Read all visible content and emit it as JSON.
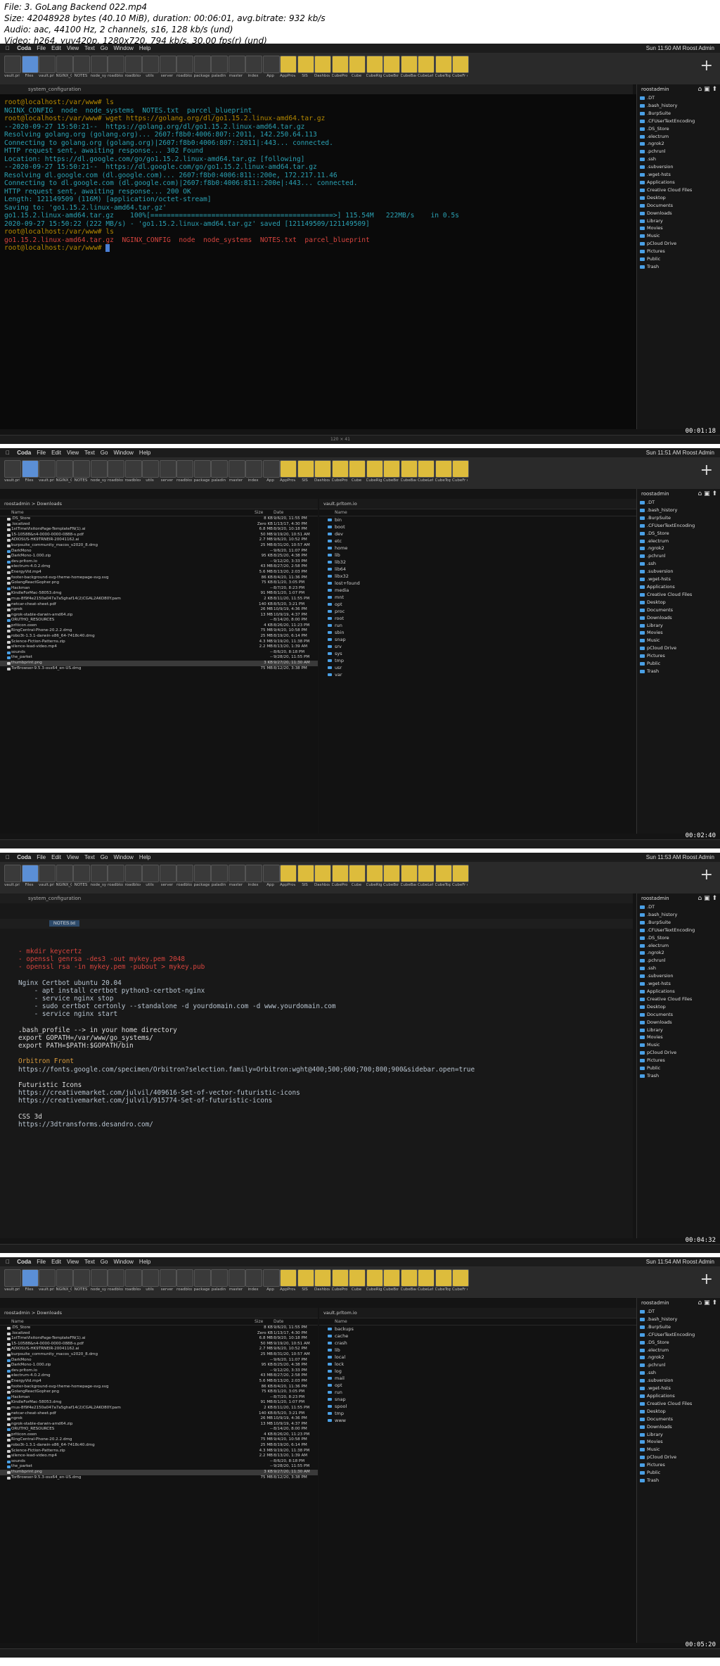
{
  "header": {
    "line1": "File: 3. GoLang Backend 022.mp4",
    "line2": "Size: 42048928 bytes (40.10 MiB), duration: 00:06:01, avg.bitrate: 932 kb/s",
    "line3": "Audio: aac, 44100 Hz, 2 channels, s16, 128 kb/s (und)",
    "line4": "Video: h264, yuv420p, 1280x720, 794 kb/s, 30.00 fps(r) (und)"
  },
  "menu": {
    "items": [
      "Coda",
      "File",
      "Edit",
      "View",
      "Text",
      "Go",
      "Window",
      "Help"
    ],
    "clock1": "Sun 11:50 AM  Roost Admin",
    "clock2": "Sun 11:51 AM  Roost Admin",
    "clock3": "Sun 11:53 AM  Roost Admin",
    "clock4": "Sun 11:54 AM  Roost Admin"
  },
  "toolbar": {
    "labels": [
      "vault.pri\nlision.io",
      "Files",
      "vault.pri\nlision",
      "NGINX_C\nONFIG",
      "NOTES",
      "node_sys\ntem",
      "roadblox\nethod.c",
      "roadblox\nethod.c",
      "utils",
      "server",
      "roadblox\nethod.c",
      "package",
      "paladin",
      "master",
      "index",
      "App",
      "AppProv\nider",
      "SIS",
      "Dashboa\nrd",
      "CubeProv\nider",
      "Cube",
      "CubeRig\nht",
      "CubeBot\ntom",
      "CubeBac\nk",
      "CubeLef\nt",
      "CubeTop",
      "CubeFr\nont"
    ]
  },
  "terminal": {
    "tab": "system_configuration",
    "lines": [
      {
        "c": "c-prompt",
        "t": "root@localhost:/var/www# ls"
      },
      {
        "c": "c-cyan",
        "t": "NGINX_CONFIG  node  node_systems  NOTES.txt  parcel_blueprint"
      },
      {
        "c": "c-prompt",
        "t": "root@localhost:/var/www# wget https://golang.org/dl/go1.15.2.linux-amd64.tar.gz"
      },
      {
        "c": "c-cyan",
        "t": "--2020-09-27 15:50:21--  https://golang.org/dl/go1.15.2.linux-amd64.tar.gz"
      },
      {
        "c": "c-cyan",
        "t": "Resolving golang.org (golang.org)... 2607:f8b0:4006:807::2011, 142.250.64.113"
      },
      {
        "c": "c-cyan",
        "t": "Connecting to golang.org (golang.org)|2607:f8b0:4006:807::2011|:443... connected."
      },
      {
        "c": "c-cyan",
        "t": "HTTP request sent, awaiting response... 302 Found"
      },
      {
        "c": "c-cyan",
        "t": "Location: https://dl.google.com/go/go1.15.2.linux-amd64.tar.gz [following]"
      },
      {
        "c": "c-cyan",
        "t": "--2020-09-27 15:50:21--  https://dl.google.com/go/go1.15.2.linux-amd64.tar.gz"
      },
      {
        "c": "c-cyan",
        "t": "Resolving dl.google.com (dl.google.com)... 2607:f8b0:4006:811::200e, 172.217.11.46"
      },
      {
        "c": "c-cyan",
        "t": "Connecting to dl.google.com (dl.google.com)|2607:f8b0:4006:811::200e|:443... connected."
      },
      {
        "c": "c-cyan",
        "t": "HTTP request sent, awaiting response... 200 OK"
      },
      {
        "c": "c-cyan",
        "t": "Length: 121149509 (116M) [application/octet-stream]"
      },
      {
        "c": "c-cyan",
        "t": "Saving to: 'go1.15.2.linux-amd64.tar.gz'"
      },
      {
        "c": "c-cyan",
        "t": ""
      },
      {
        "c": "c-cyan",
        "t": "go1.15.2.linux-amd64.tar.gz    100%[=============================================>] 115.54M   222MB/s    in 0.5s"
      },
      {
        "c": "c-cyan",
        "t": ""
      },
      {
        "c": "c-cyan",
        "t": "2020-09-27 15:50:22 (222 MB/s) - 'go1.15.2.linux-amd64.tar.gz' saved [121149509/121149509]"
      },
      {
        "c": "c-cyan",
        "t": ""
      },
      {
        "c": "c-prompt",
        "t": "root@localhost:/var/www# ls"
      },
      {
        "c": "c-red",
        "t": "go1.15.2.linux-amd64.tar.gz  NGINX_CONFIG  node  node_systems  NOTES.txt  parcel_blueprint"
      },
      {
        "c": "c-prompt",
        "t": "root@localhost:/var/www# "
      }
    ],
    "size_label": "120 × 41"
  },
  "sidebar": {
    "head": "roostadmin",
    "items": [
      ".DT",
      ".bash_history",
      ".BurpSuite",
      ".CFUserTextEncoding",
      ".DS_Store",
      ".electrum",
      ".ngrok2",
      ".pchrunl",
      ".ssh",
      ".subversion",
      ".wget-hsts",
      "Applications",
      "Creative Cloud Files",
      "Desktop",
      "Documents",
      "Downloads",
      "Library",
      "Movies",
      "Music",
      "pCloud Drive",
      "Pictures",
      "Public",
      "Trash"
    ]
  },
  "files": {
    "path": "roostadmin  >  Downloads",
    "col_name": "Name",
    "col_size": "Size",
    "col_date": "Date",
    "rows": [
      {
        "n": ".DS_Store",
        "s": "8 KB",
        "d": "9/6/20, 11:55 PM",
        "f": false
      },
      {
        "n": ".localized",
        "s": "Zero KB",
        "d": "1/13/17, 4:30 PM",
        "f": false
      },
      {
        "n": "1stTimeVisitorsPage-TemplateFN(1).ai",
        "s": "6.8 MB",
        "d": "8/9/20, 10:18 PM",
        "f": false
      },
      {
        "n": "15-10588&n4-0000-0000-0888-s.pdf",
        "s": "50 MB",
        "d": "9/19/20, 10:51 AM",
        "f": false
      },
      {
        "n": "ADIOSUS-HK9TRNEIR-20041162.ai",
        "s": "2.7 MB",
        "d": "9/6/20, 10:52 PM",
        "f": false
      },
      {
        "n": "burpsuite_community_macos_v2020_8.dmg",
        "s": "25 MB",
        "d": "8/31/20, 10:57 AM",
        "f": false
      },
      {
        "n": "DarkMono",
        "s": "--",
        "d": "9/6/20, 11:07 PM",
        "f": true
      },
      {
        "n": "DarkMono-1.000.zip",
        "s": "95 KB",
        "d": "8/25/20, 4:38 PM",
        "f": false
      },
      {
        "n": "dev.prltom.io",
        "s": "--",
        "d": "9/12/20, 3:33 PM",
        "f": true
      },
      {
        "n": "electrum-4.0.2.dmg",
        "s": "43 MB",
        "d": "8/27/20, 2:58 PM",
        "f": false
      },
      {
        "n": "EnergyVid.mp4",
        "s": "5.6 MB",
        "d": "8/13/20, 2:03 PM",
        "f": false
      },
      {
        "n": "footer-background-svg-theme-homepage-svg.svg",
        "s": "86 KB",
        "d": "8/4/20, 11:36 PM",
        "f": false
      },
      {
        "n": "GolangReactGopher.png",
        "s": "75 KB",
        "d": "8/1/20, 3:05 PM",
        "f": false
      },
      {
        "n": "Hackman",
        "s": "--",
        "d": "8/7/20, 8:23 PM",
        "f": true
      },
      {
        "n": "KindleForMac-58053.dmg",
        "s": "91 MB",
        "d": "8/1/20, 1:07 PM",
        "f": false
      },
      {
        "n": "mus-8f9f4e2150a047a7a5ghaf14(2)CGAL2AKO80Y.pam",
        "s": "2 KB",
        "d": "8/11/20, 11:55 PM",
        "f": false
      },
      {
        "n": "netcar-cheat-sheet.pdf",
        "s": "140 KB",
        "d": "8/5/20, 3:21 PM",
        "f": false
      },
      {
        "n": "ngrok",
        "s": "26 MB",
        "d": "10/9/19, 4:36 PM",
        "f": false
      },
      {
        "n": "ngrok-stable-darwin-amd64.zip",
        "s": "13 MB",
        "d": "10/9/19, 4:37 PM",
        "f": false
      },
      {
        "n": "ORUTHO_RESOURCES",
        "s": "--",
        "d": "8/14/20, 8:00 PM",
        "f": true
      },
      {
        "n": "prlticon.oxen",
        "s": "4 KB",
        "d": "8/26/20, 11:23 PM",
        "f": false
      },
      {
        "n": "RingCentral-Phone-20.2.2.dmg",
        "s": "75 MB",
        "d": "9/4/20, 10:58 PM",
        "f": false
      },
      {
        "n": "robo3t-1.3.1-darwin-x86_64-7418c40.dmg",
        "s": "25 MB",
        "d": "8/19/20, 6:14 PM",
        "f": false
      },
      {
        "n": "Science-Fiction-Patterns.zip",
        "s": "4.3 MB",
        "d": "9/19/20, 11:38 PM",
        "f": false
      },
      {
        "n": "silence-lead-video.mp4",
        "s": "2.2 MB",
        "d": "8/13/20, 1:39 AM",
        "f": false
      },
      {
        "n": "sounds",
        "s": "--",
        "d": "8/6/20, 8:18 PM",
        "f": true
      },
      {
        "n": "the_parket",
        "s": "--",
        "d": "9/28/20, 11:55 PM",
        "f": true
      },
      {
        "n": "thumbprint.png",
        "s": "3 KB",
        "d": "9/27/20, 11:30 AM",
        "f": false
      },
      {
        "n": "TorBrowser-9.5.3-osx64_en-US.dmg",
        "s": "75 MB",
        "d": "8/12/20, 3:38 PM",
        "f": false
      }
    ]
  },
  "remote": {
    "path2": "vault.prltom.io",
    "rows2": [
      "bin",
      "boot",
      "dev",
      "etc",
      "home",
      "lib",
      "lib32",
      "lib64",
      "libx32",
      "lost+found",
      "media",
      "mnt",
      "opt",
      "proc",
      "root",
      "run",
      "sbin",
      "snap",
      "srv",
      "sys",
      "tmp",
      "usr",
      "var"
    ],
    "rows4": [
      "backups",
      "cache",
      "crash",
      "lib",
      "local",
      "lock",
      "log",
      "mail",
      "opt",
      "run",
      "snap",
      "spool",
      "tmp",
      "www"
    ]
  },
  "editor": {
    "tab": "NOTES.txt",
    "lines": [
      {
        "c": "c-red",
        "t": "- mkdir keycertz"
      },
      {
        "c": "c-red",
        "t": "- openssl genrsa -des3 -out mykey.pem 2048"
      },
      {
        "c": "c-red",
        "t": "- openssl rsa -in mykey.pem -pubout > mykey.pub"
      },
      {
        "c": "",
        "t": ""
      },
      {
        "c": "c-link",
        "t": "Nginx Certbot ubuntu 20.04"
      },
      {
        "c": "c-link",
        "t": "    - apt install certbot python3-certbot-nginx"
      },
      {
        "c": "c-link",
        "t": "    - service nginx stop"
      },
      {
        "c": "c-link",
        "t": "    - sudo certbot certonly --standalone -d yourdomain.com -d www.yourdomain.com"
      },
      {
        "c": "c-link",
        "t": "    - service nginx start"
      },
      {
        "c": "",
        "t": ""
      },
      {
        "c": "c-white",
        "t": ".bash_profile --> in your home directory"
      },
      {
        "c": "c-white",
        "t": "export GOPATH=/var/www/go_systems/"
      },
      {
        "c": "c-white",
        "t": "export PATH=$PATH:$GOPATH/bin"
      },
      {
        "c": "",
        "t": ""
      },
      {
        "c": "c-orange",
        "t": "Orbitron Front"
      },
      {
        "c": "c-link",
        "t": "https://fonts.google.com/specimen/Orbitron?selection.family=Orbitron:wght@400;500;600;700;800;900&sidebar.open=true"
      },
      {
        "c": "",
        "t": ""
      },
      {
        "c": "c-white",
        "t": "Futuristic Icons"
      },
      {
        "c": "c-link",
        "t": "https://creativemarket.com/julvil/409616-Set-of-vector-futuristic-icons"
      },
      {
        "c": "c-link",
        "t": "https://creativemarket.com/julvil/915774-Set-of-futuristic-icons"
      },
      {
        "c": "",
        "t": ""
      },
      {
        "c": "c-white",
        "t": "CSS 3d"
      },
      {
        "c": "c-link",
        "t": "https://3dtransforms.desandro.com/"
      }
    ]
  },
  "timestamps": [
    "00:01:18",
    "00:02:40",
    "00:04:32",
    "00:05:20"
  ],
  "colors": {
    "terminal_bg": "#0a0a0a",
    "prompt": "#b58900",
    "cyan": "#2aa1b3",
    "red": "#d7443e",
    "folder": "#4aa0e6"
  }
}
